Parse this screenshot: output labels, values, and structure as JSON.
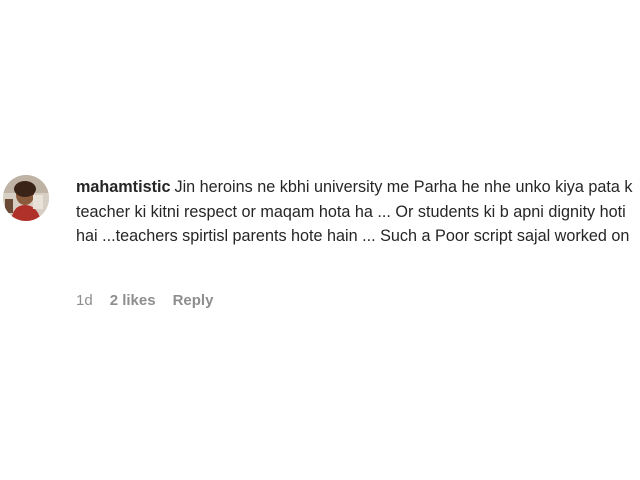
{
  "comment": {
    "username": "mahamtistic",
    "text": "Jin heroins ne kbhi university me Parha he nhe unko kiya pata k teacher ki kitni respect or maqam hota ha ... Or students ki b apni dignity hoti hai ...teachers spirtisl parents hote hain ... Such a Poor script sajal worked on",
    "time": "1d",
    "likes": "2 likes",
    "reply_label": "Reply"
  },
  "colors": {
    "text": "#262626",
    "meta": "#8e8e8e",
    "background": "#ffffff"
  }
}
